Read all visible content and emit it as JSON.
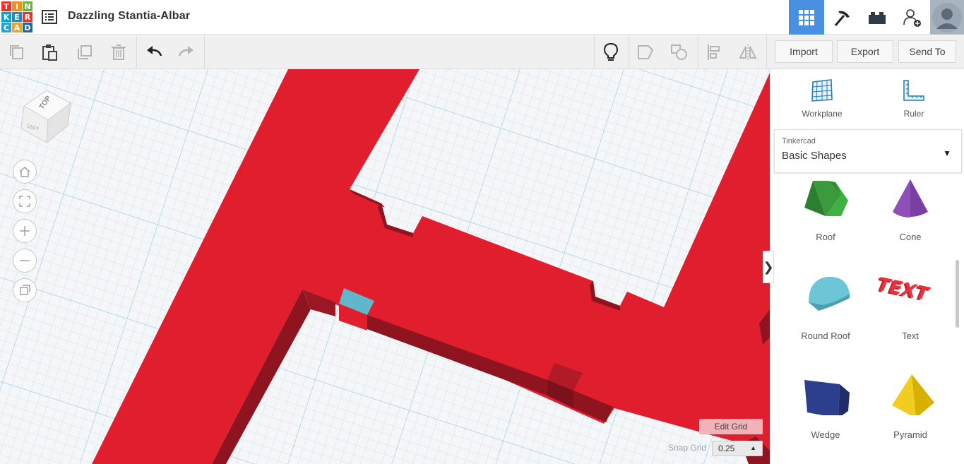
{
  "header": {
    "logo_letters": [
      "T",
      "I",
      "N",
      "K",
      "E",
      "R",
      "C",
      "A",
      "D"
    ],
    "project_title": "Dazzling Stantia-Albar",
    "icons": [
      "list-icon",
      "grid-3d-icon",
      "pickaxe-icon",
      "brick-icon",
      "add-user-icon",
      "avatar"
    ]
  },
  "toolbar": {
    "import_label": "Import",
    "export_label": "Export",
    "send_to_label": "Send To",
    "icons": [
      "copy-icon",
      "paste-icon",
      "duplicate-icon",
      "delete-icon",
      "undo-icon",
      "redo-icon",
      "lightbulb-icon",
      "group-icon",
      "ungroup-icon",
      "align-icon",
      "mirror-icon"
    ]
  },
  "canvas": {
    "viewcube": {
      "top_label": "TOP",
      "left_label": "LEFT"
    },
    "nav_icons": [
      "home-icon",
      "fit-icon",
      "zoom-in-icon",
      "zoom-out-icon",
      "ortho-icon"
    ],
    "edit_grid_label": "Edit Grid",
    "snap_grid_label": "Snap Grid",
    "snap_grid_value": "0.25"
  },
  "panel": {
    "tools": [
      {
        "label": "Workplane"
      },
      {
        "label": "Ruler"
      }
    ],
    "library": {
      "source": "Tinkercad",
      "category": "Basic Shapes"
    },
    "shapes": [
      {
        "label": "Roof"
      },
      {
        "label": "Cone"
      },
      {
        "label": "Round Roof"
      },
      {
        "label": "Text"
      },
      {
        "label": "Wedge"
      },
      {
        "label": "Pyramid"
      }
    ]
  },
  "colors": {
    "accent_blue": "#4a90e2",
    "model_red": "#e01e2e",
    "model_dark_red": "#8e1520",
    "grid_line": "#b8d8ec"
  }
}
